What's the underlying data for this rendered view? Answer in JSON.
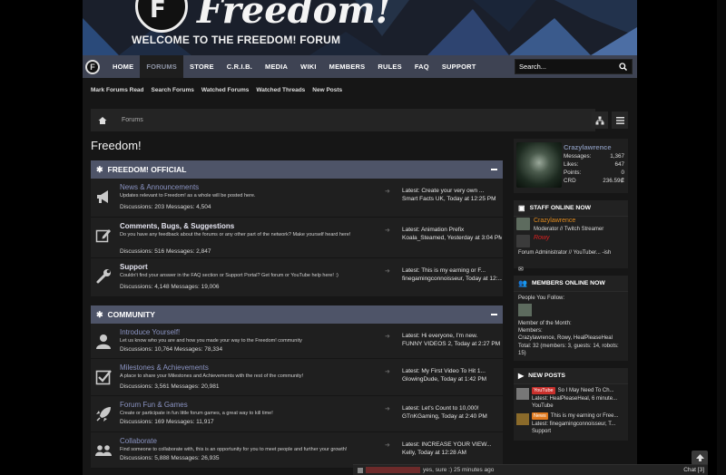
{
  "banner": {
    "logo_letter": "F",
    "logo_text": "Freedom!",
    "welcome": "WELCOME TO THE FREEDOM! FORUM"
  },
  "nav": {
    "logo_letter": "F",
    "items": [
      "HOME",
      "FORUMS",
      "STORE",
      "C.R.I.B.",
      "MEDIA",
      "WIKI",
      "MEMBERS",
      "RULES",
      "FAQ",
      "SUPPORT"
    ],
    "active": "FORUMS",
    "search_placeholder": "Search..."
  },
  "subnav": [
    "Mark Forums Read",
    "Search Forums",
    "Watched Forums",
    "Watched Threads",
    "New Posts"
  ],
  "breadcrumb": {
    "label": "Forums"
  },
  "page_title": "Freedom!",
  "categories": [
    {
      "title": "FREEDOM! OFFICIAL",
      "forums": [
        {
          "icon": "megaphone-icon",
          "title": "News & Announcements",
          "desc": "Updates relevant to Freedom! as a whole will be posted here.",
          "stats": "Discussions: 203 Messages: 4,504",
          "latest1": "Latest: Create your very own ...",
          "latest2": "Smart Facts UK, Today at 12:25 PM"
        },
        {
          "icon": "edit-icon",
          "title": "Comments, Bugs, & Suggestions",
          "desc": "Do you have any feedback about the forums or any other part of the network? Make yourself heard here!",
          "stats": "Discussions: 516 Messages: 2,847",
          "latest1": "Latest: Animation Prefix",
          "latest2": "Koala_Steamed, Yesterday at 3:04 PM"
        },
        {
          "icon": "wrench-icon",
          "title": "Support",
          "desc": "Couldn't find your answer in the FAQ section or Support Portal? Get forum or YouTube help here! :)",
          "stats": "Discussions: 4,148 Messages: 19,006",
          "latest1": "Latest: This is my earning or F...",
          "latest2": "finegamingconnoisseur, Today at 12:..."
        }
      ]
    },
    {
      "title": "COMMUNITY",
      "forums": [
        {
          "icon": "user-icon",
          "title": "Introduce Yourself!",
          "desc": "Let us know who you are and how you made your way to the Freedom! community",
          "stats": "Discussions: 10,764 Messages: 78,334",
          "latest1": "Latest: Hi everyone, I'm new.",
          "latest2": "FUNNY VIDEOS 2, Today at 2:27 PM"
        },
        {
          "icon": "checkbox-icon",
          "title": "Milestones & Achievements",
          "desc": "A place to share your Milestones and Achievements with the rest of the community!",
          "stats": "Discussions: 3,561 Messages: 20,981",
          "latest1": "Latest: My First Video To Hit 1...",
          "latest2": "GlowingDude, Today at 1:42 PM"
        },
        {
          "icon": "rocket-icon",
          "title": "Forum Fun & Games",
          "desc": "Create or participate in fun little forum games, a great way to kill time!",
          "stats": "Discussions: 169 Messages: 11,917",
          "latest1": "Latest: Let's Count to 10,000!",
          "latest2": "GTnKGaming, Today at 2:40 PM"
        },
        {
          "icon": "group-icon",
          "title": "Collaborate",
          "desc": "Find someone to collaborate with, this is an opportunity for you to meet people and further your growth!",
          "stats": "Discussions: 5,888 Messages: 26,935",
          "latest1": "Latest: INCREASE YOUR VIEW...",
          "latest2": "Kelly, Today at 12:28 AM"
        }
      ]
    }
  ],
  "profile": {
    "name": "Crazylawrence",
    "rows": [
      {
        "label": "Messages:",
        "value": "1,367"
      },
      {
        "label": "Likes:",
        "value": "647"
      },
      {
        "label": "Points:",
        "value": "0"
      },
      {
        "label": "CRD",
        "value": "236.59₡"
      }
    ]
  },
  "staff": {
    "title": "STAFF ONLINE NOW",
    "members": [
      {
        "name": "Crazylawrence",
        "role": "Moderator // Twitch Streamer",
        "color": "#e08a1e"
      },
      {
        "name": "Rowy",
        "role": "",
        "color": "#d82020"
      }
    ],
    "extra": "Forum Administrator // YouTuber... -ish"
  },
  "members_online": {
    "title": "MEMBERS ONLINE NOW",
    "follow_label": "People You Follow:",
    "motm_label": "Member of the Month:",
    "members_label": "Members:",
    "members_list": "Crazylawrence, Rowy, HealPleaseHeal",
    "total": "Total: 32 (members: 3, guests: 14, robots: 15)"
  },
  "new_posts": {
    "title": "NEW POSTS",
    "posts": [
      {
        "badge": "YouTube",
        "title": "So I May Need To Ch...",
        "latest": "Latest: HealPleaseHeal, 6 minute...",
        "forum": "YouTube"
      },
      {
        "badge": "News",
        "title": "This is my earning or Free...",
        "latest": "Latest: finegamingconnoisseur, T...",
        "forum": "Support"
      }
    ]
  },
  "chat": {
    "message": "yes, sure :) 25 minutes ago",
    "button": "Chat [3]"
  },
  "colors": {
    "nav": "#3e4353",
    "category": "#4e5468",
    "link": "#8a93c2"
  }
}
